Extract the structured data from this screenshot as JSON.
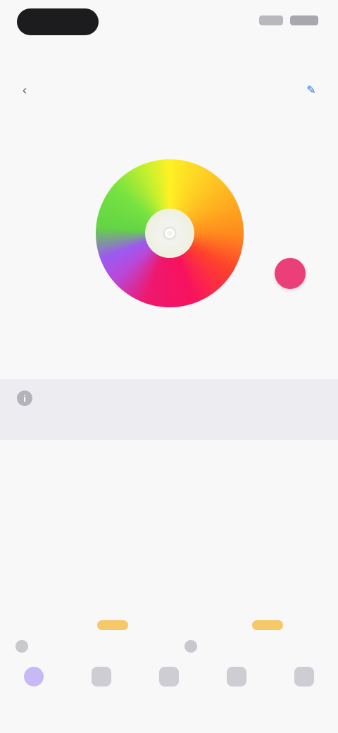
{
  "status_bar": {},
  "tabs": [
    {
      "label": "",
      "state": "active"
    },
    {
      "label": "",
      "state": "default"
    },
    {
      "label": "",
      "state": "blue"
    },
    {
      "label": "",
      "state": "default"
    }
  ],
  "toolbar": {
    "title": "",
    "back_icon": "back-icon",
    "action_icon": "edit-icon"
  },
  "color_section": {
    "title": "",
    "wheel_icon": "color-wheel",
    "selected_color": "#ea3f79",
    "left_label": "",
    "left_sub": "",
    "right_label": "",
    "right_sub": ""
  },
  "info": {
    "icon": "info-icon",
    "title": "",
    "subtitle": ""
  },
  "description": "",
  "features_section": {
    "title": "",
    "items": [
      {
        "label": "",
        "badge": ""
      },
      {
        "label": "",
        "badge": ""
      }
    ]
  },
  "bottom_nav": [
    {
      "label": "",
      "active": true
    },
    {
      "label": "",
      "active": false
    },
    {
      "label": "",
      "active": false
    },
    {
      "label": "",
      "active": false
    },
    {
      "label": "",
      "active": false
    }
  ],
  "colors": {
    "accent": "#1a73e8",
    "nav_active": "#8a78e6",
    "info_band": "#ededf1",
    "badge": "#f6c867"
  }
}
